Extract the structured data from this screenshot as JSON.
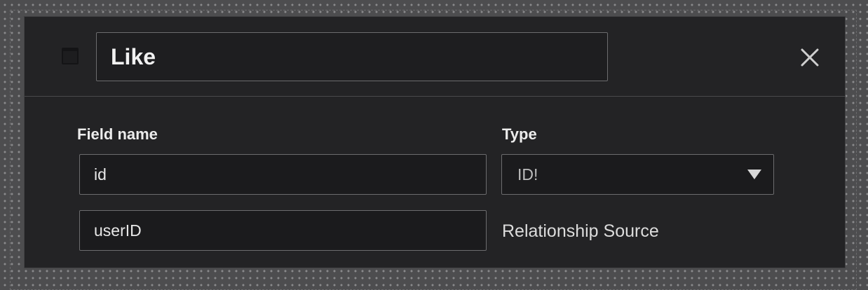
{
  "model": {
    "name": "Like"
  },
  "columns": {
    "field_name_label": "Field name",
    "type_label": "Type"
  },
  "fields": [
    {
      "name": "id",
      "type": "ID!"
    },
    {
      "name": "userID",
      "relationship_note": "Relationship Source"
    }
  ],
  "icons": {
    "model": "model-window-icon",
    "close": "close-icon",
    "dropdown": "chevron-down-icon"
  },
  "colors": {
    "panel_background": "#232325",
    "canvas_background": "#4d4d4f",
    "input_border": "#6c6c6e",
    "text": "#ececec"
  }
}
